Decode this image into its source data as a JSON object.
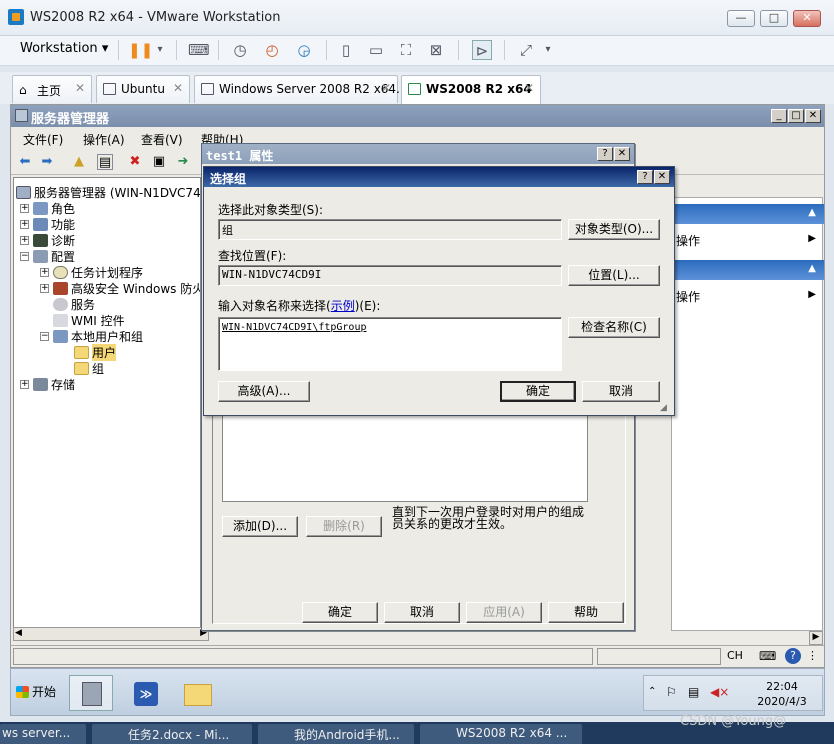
{
  "vmware": {
    "title": "WS2008 R2 x64 - VMware Workstation",
    "menu_label": "Workstation",
    "window_buttons": {
      "minimize": "—",
      "maximize": "□",
      "close": "✕"
    },
    "tabs": [
      {
        "label": "主页"
      },
      {
        "label": "Ubuntu"
      },
      {
        "label": "Windows Server 2008 R2 x64..."
      },
      {
        "label": "WS2008 R2 x64"
      }
    ]
  },
  "server_manager": {
    "title": "服务器管理器",
    "menu": [
      "文件(F)",
      "操作(A)",
      "查看(V)",
      "帮助(H)"
    ],
    "tree": [
      {
        "label": "服务器管理器 (WIN-N1DVC74C"
      },
      {
        "label": "角色"
      },
      {
        "label": "功能"
      },
      {
        "label": "诊断"
      },
      {
        "label": "配置"
      },
      {
        "label": "任务计划程序"
      },
      {
        "label": "高级安全 Windows 防火"
      },
      {
        "label": "服务"
      },
      {
        "label": "WMI 控件"
      },
      {
        "label": "本地用户和组"
      },
      {
        "label": "用户"
      },
      {
        "label": "组"
      },
      {
        "label": "存储"
      }
    ],
    "actions": [
      "操作",
      "操作"
    ],
    "status_bar": {
      "ime": "CH"
    }
  },
  "properties_dialog": {
    "title": "test1 属性",
    "add_button": "添加(D)...",
    "remove_button": "删除(R)",
    "note": "直到下一次用户登录时对用户的组成员关系的更改才生效。",
    "ok_button": "确定",
    "cancel_button": "取消",
    "apply_button": "应用(A)",
    "help_button": "帮助"
  },
  "select_group_dialog": {
    "title": "选择组",
    "object_type_label": "选择此对象类型(S):",
    "object_type_value": "组",
    "object_types_button": "对象类型(O)...",
    "location_label": "查找位置(F):",
    "location_value": "WIN-N1DVC74CD9I",
    "location_button": "位置(L)...",
    "enter_names_label_prefix": "输入对象名称来选择(",
    "examples_link": "示例",
    "enter_names_label_suffix": ")(E):",
    "entered_name": "WIN-N1DVC74CD9I\\ftpGroup",
    "check_names_button": "检查名称(C)",
    "advanced_button": "高级(A)...",
    "ok_button": "确定",
    "cancel_button": "取消"
  },
  "guest_taskbar": {
    "start_label": "开始",
    "clock_time": "22:04",
    "clock_date": "2020/4/3"
  },
  "host_taskbar": {
    "items": [
      "ws server...",
      "任务2.docx - Mi...",
      "我的Android手机...",
      "WS2008 R2 x64 ..."
    ]
  },
  "watermark": "CSDN @Young@"
}
